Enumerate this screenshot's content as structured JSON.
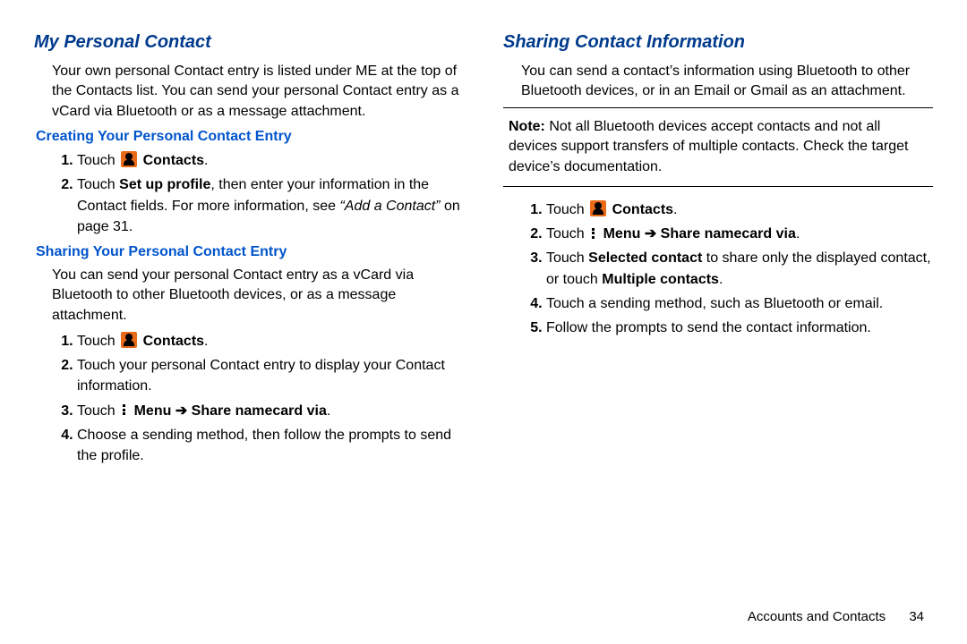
{
  "left": {
    "h1": "My Personal Contact",
    "intro": "Your own personal Contact entry is listed under ME at the top of the Contacts list. You can send your personal Contact entry as a vCard via Bluetooth or as a message attachment.",
    "sec1_h2": "Creating Your Personal Contact Entry",
    "sec1_step1_touch": "Touch ",
    "sec1_step1_contacts": "Contacts",
    "sec1_step1_period": ".",
    "sec1_step2_a": "Touch ",
    "sec1_step2_setup": "Set up profile",
    "sec1_step2_b": ", then enter your information in the Contact fields. For more information, see ",
    "sec1_step2_ref": "“Add a Contact” ",
    "sec1_step2_c": "on page 31.",
    "sec2_h2": "Sharing Your Personal Contact Entry",
    "sec2_intro": "You can send your personal Contact entry as a vCard via Bluetooth to other Bluetooth devices, or as a message attachment.",
    "sec2_step1_touch": "Touch ",
    "sec2_step1_contacts": "Contacts",
    "sec2_step1_period": ".",
    "sec2_step2": "Touch your personal Contact entry to display your Contact information.",
    "sec2_step3_touch": "Touch ",
    "sec2_step3_menu": "Menu",
    "sec2_step3_arrow": " ➔ ",
    "sec2_step3_share": "Share namecard via",
    "sec2_step3_period": ".",
    "sec2_step4": "Choose a sending method, then follow the prompts to send the profile."
  },
  "right": {
    "h1": "Sharing Contact Information",
    "intro": "You can send a contact’s information using Bluetooth to other Bluetooth devices, or in an Email or Gmail as an attachment.",
    "note_label": "Note: ",
    "note": "Not all Bluetooth devices accept contacts and not all devices support transfers of multiple contacts. Check the target device’s documentation.",
    "step1_touch": "Touch ",
    "step1_contacts": "Contacts",
    "step1_period": ".",
    "step2_touch": "Touch ",
    "step2_menu": "Menu",
    "step2_arrow": " ➔ ",
    "step2_share": "Share namecard via",
    "step2_period": ".",
    "step3_a": "Touch ",
    "step3_sel": "Selected contact",
    "step3_b": " to share only the displayed contact, or touch ",
    "step3_mul": "Multiple contacts",
    "step3_c": ".",
    "step4": "Touch a sending method, such as Bluetooth or email.",
    "step5": "Follow the prompts to send the contact information."
  },
  "footer": {
    "section": "Accounts and Contacts",
    "page": "34"
  }
}
